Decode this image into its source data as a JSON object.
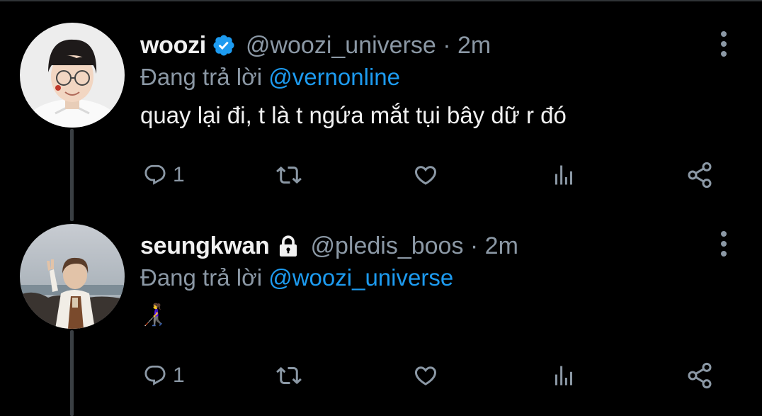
{
  "colors": {
    "background": "#000000",
    "muted": "#8b98a5",
    "link": "#1d9bf0",
    "verified": "#1d9bf0",
    "text": "#f1f1f1"
  },
  "tweets": [
    {
      "display_name": "woozi",
      "badge_icon": "verified-badge-icon",
      "handle_time": "@woozi_universe · 2m",
      "reply_prefix": "Đang trả lời ",
      "reply_to": "@vernonline",
      "text": "quay lại đi, t là t ngứa mắt tụi bây dữ r đó",
      "reply_count": "1",
      "icons": [
        "reply-icon",
        "retweet-icon",
        "like-icon",
        "analytics-icon",
        "share-icon"
      ]
    },
    {
      "display_name": "seungkwan",
      "badge_icon": "lock-icon",
      "handle_time": "@pledis_boos · 2m",
      "reply_prefix": "Đang trả lời ",
      "reply_to": "@woozi_universe",
      "text": "👩‍🦯",
      "reply_count": "1",
      "icons": [
        "reply-icon",
        "retweet-icon",
        "like-icon",
        "analytics-icon",
        "share-icon"
      ]
    }
  ]
}
